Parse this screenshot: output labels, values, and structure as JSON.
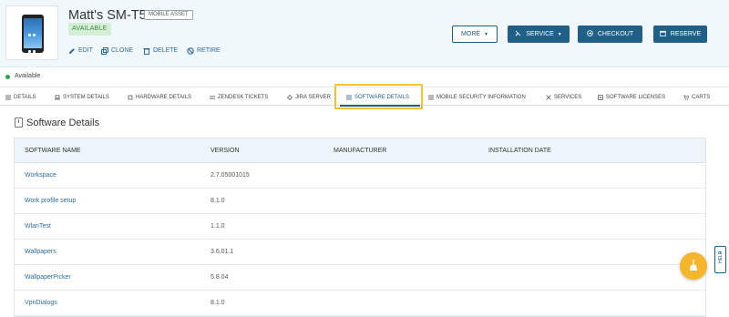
{
  "asset": {
    "title": "Matt's SM-T580",
    "type_badge": "MOBILE ASSET",
    "status_badge": "AVAILABLE"
  },
  "actions": [
    {
      "label": "EDIT",
      "icon": "pencil-icon"
    },
    {
      "label": "CLONE",
      "icon": "clone-icon"
    },
    {
      "label": "DELETE",
      "icon": "trash-icon"
    },
    {
      "label": "RETIRE",
      "icon": "ban-icon"
    }
  ],
  "buttons": {
    "more": "MORE",
    "service": "SERVICE",
    "checkout": "CHECKOUT",
    "reserve": "RESERVE"
  },
  "status_row": {
    "text": "Available",
    "color": "#2ba84a"
  },
  "tabs": [
    {
      "label": "DETAILS",
      "icon": "list-icon"
    },
    {
      "label": "SYSTEM DETAILS",
      "icon": "laptop-icon"
    },
    {
      "label": "HARDWARE DETAILS",
      "icon": "chip-icon"
    },
    {
      "label": "ZENDESK TICKETS",
      "icon": "zendesk-icon"
    },
    {
      "label": "JIRA SERVER",
      "icon": "jira-icon"
    },
    {
      "label": "SOFTWARE DETAILS",
      "icon": "list-icon",
      "active": true
    },
    {
      "label": "MOBILE SECURITY INFORMATION",
      "icon": "list-icon"
    },
    {
      "label": "SERVICES",
      "icon": "wrench-icon"
    },
    {
      "label": "SOFTWARE LICENSES",
      "icon": "license-icon"
    },
    {
      "label": "CARTS",
      "icon": "cart-icon"
    }
  ],
  "section": {
    "title": "Software Details"
  },
  "table": {
    "columns": [
      "SOFTWARE NAME",
      "VERSION",
      "MANUFACTURER",
      "INSTALLATION DATE"
    ],
    "rows": [
      {
        "name": "Workspace",
        "version": "2.7.05001015"
      },
      {
        "name": "Work profile setup",
        "version": "8.1.0"
      },
      {
        "name": "WlanTest",
        "version": "1.1.0"
      },
      {
        "name": "Wallpapers",
        "version": "3.6.01.1"
      },
      {
        "name": "WallpaperPicker",
        "version": "5.8.04"
      },
      {
        "name": "VpnDialogs",
        "version": "8.1.0"
      }
    ]
  },
  "help": {
    "label": "HELP"
  },
  "colors": {
    "accent": "#1f5f88",
    "link": "#2f6b9a",
    "highlight": "#f2c230",
    "fab": "#f5b52c"
  }
}
